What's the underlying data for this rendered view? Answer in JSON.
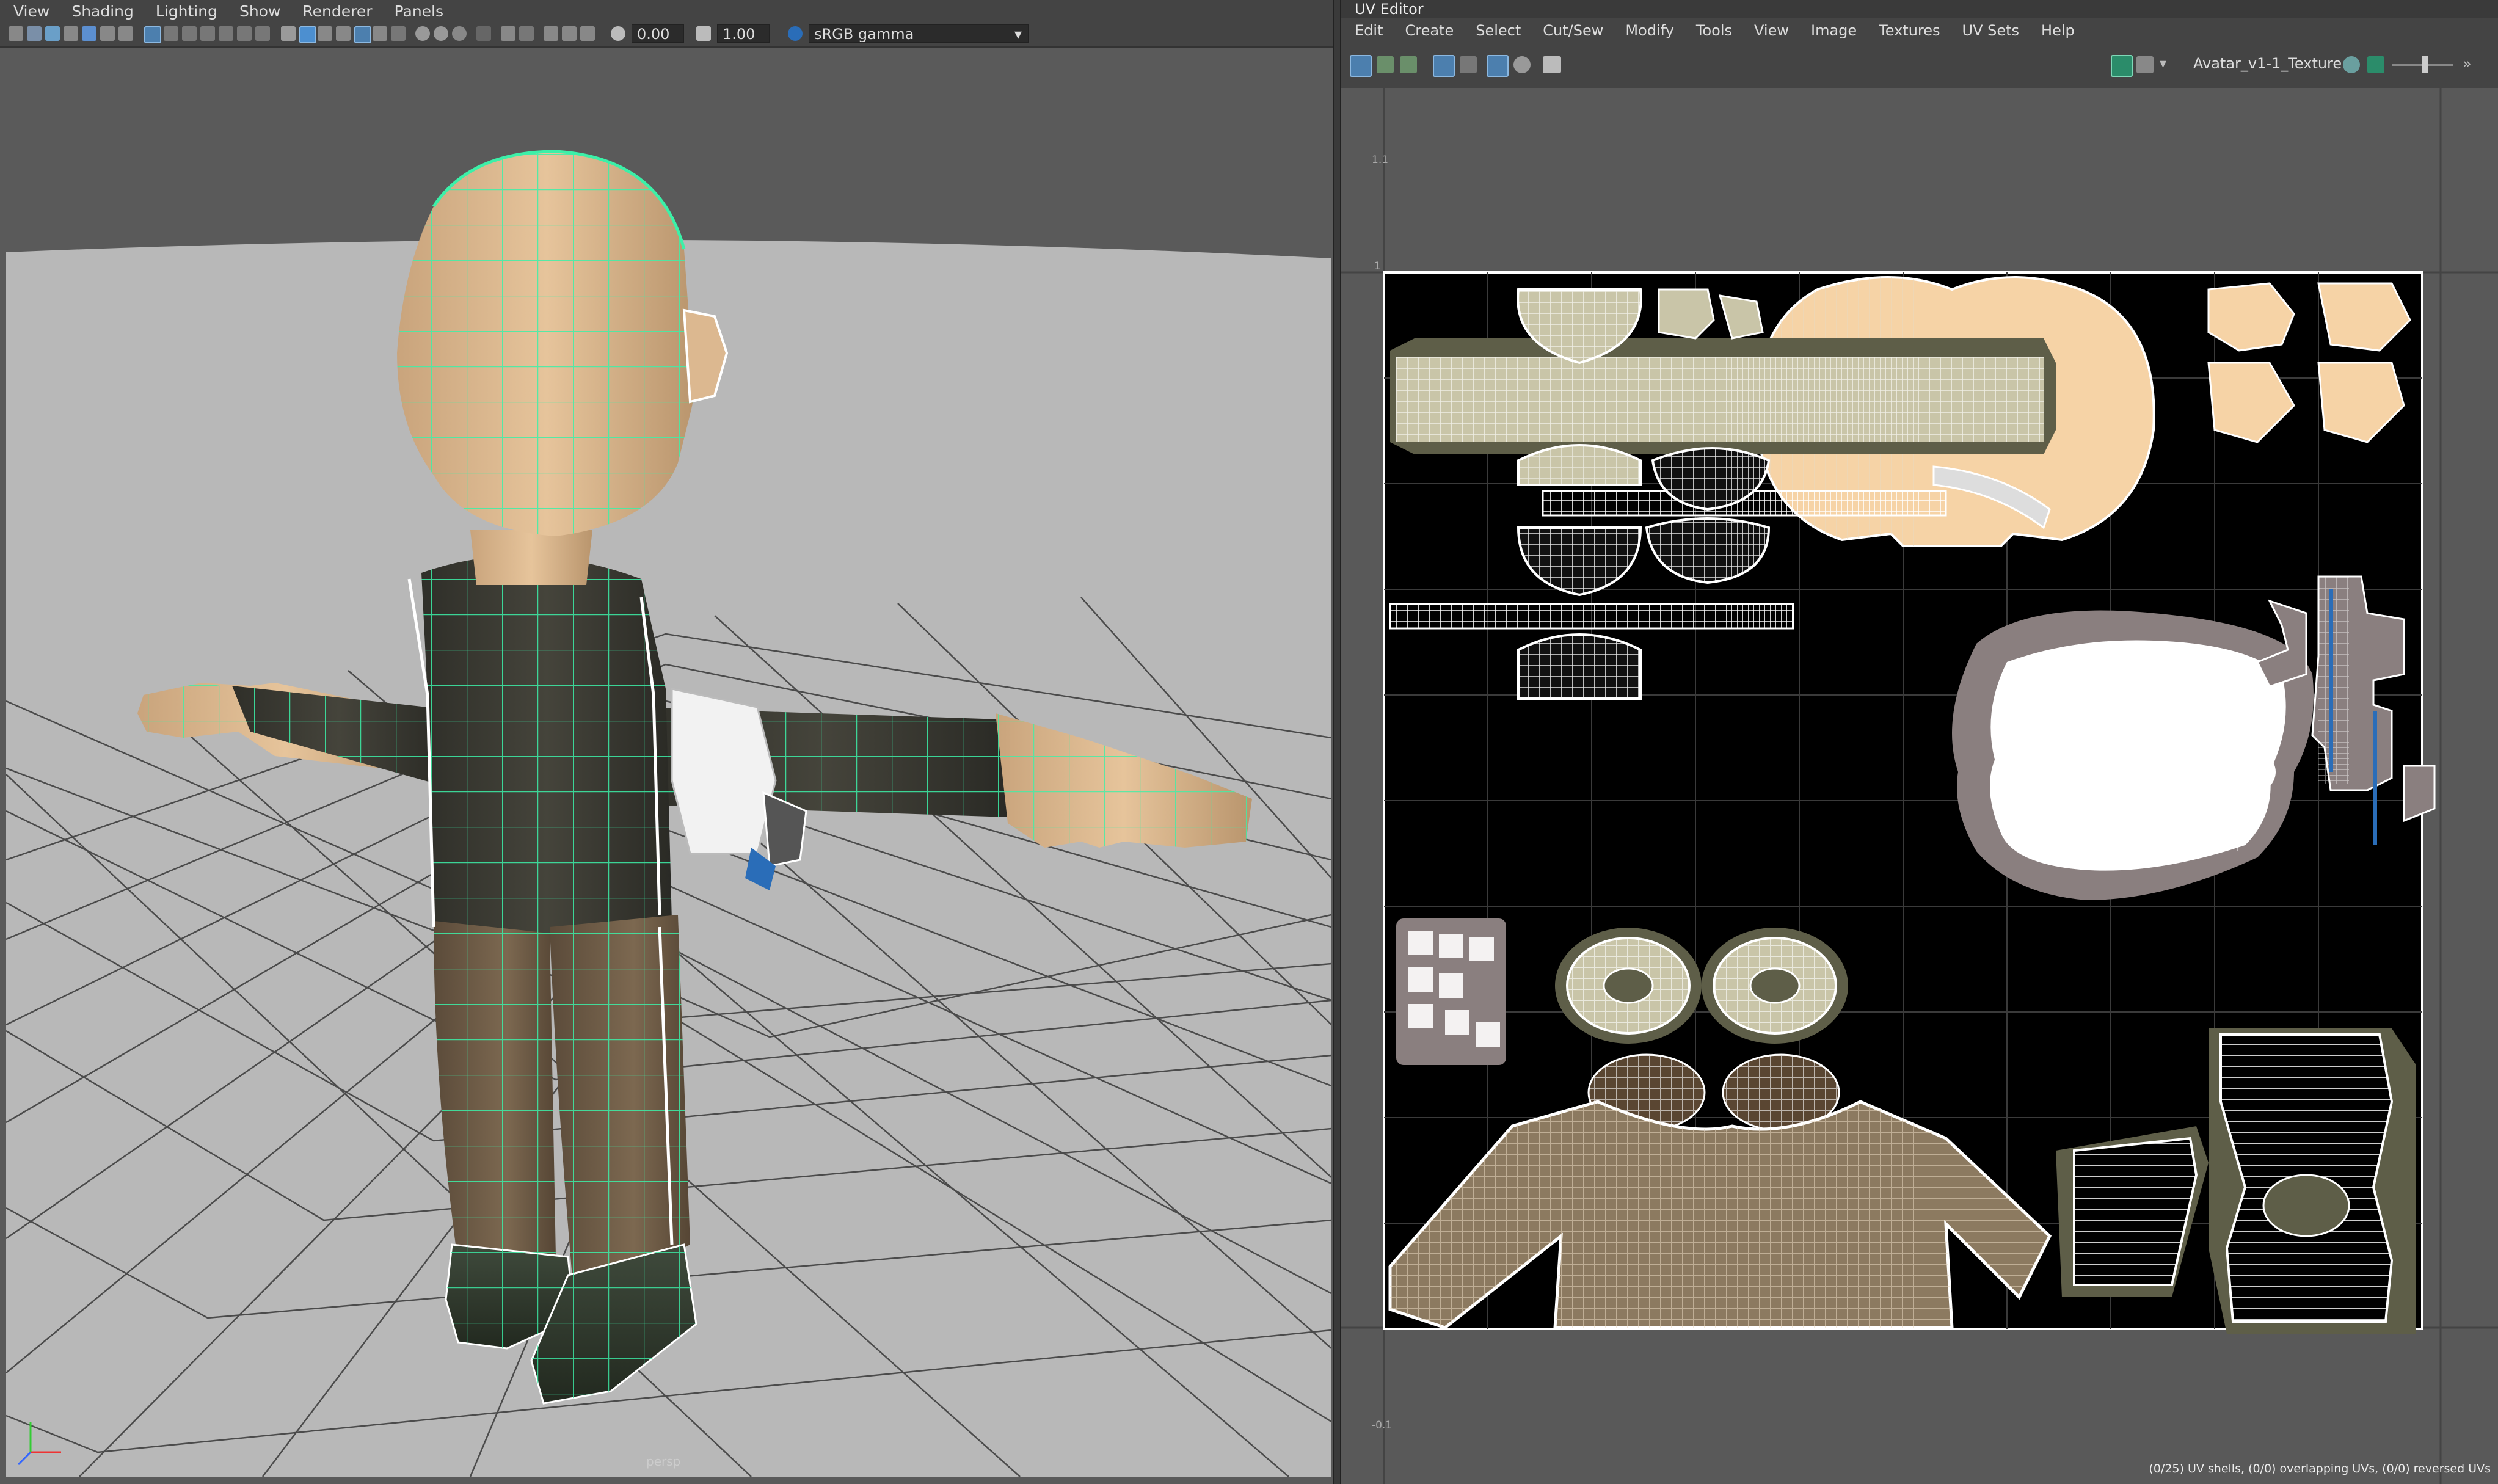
{
  "viewport": {
    "menu": [
      "View",
      "Shading",
      "Lighting",
      "Show",
      "Renderer",
      "Panels"
    ],
    "exposure_value": "0.00",
    "gamma_value": "1.00",
    "color_space": "sRGB gamma",
    "camera_label": "persp"
  },
  "uv_editor": {
    "title": "UV Editor",
    "menu": [
      "Edit",
      "Create",
      "Select",
      "Cut/Sew",
      "Modify",
      "Tools",
      "View",
      "Image",
      "Textures",
      "UV Sets",
      "Help"
    ],
    "texture_name": "Avatar_v1-1_Texture",
    "status": "(0/25) UV shells, (0/0) overlapping UVs, (0/0) reversed UVs",
    "axis_top": "1.1",
    "axis_one": "1",
    "axis_bottom": "-0.1"
  },
  "colors": {
    "viewport_bg": "#5a5a5a",
    "ground": "#b8b8b8",
    "skin": "#e3c097",
    "shirt": "#3b3a33",
    "pants": "#6b5a46",
    "wire": "#3cf0a8",
    "uv_black": "#000000",
    "uv_skin": "#f8d5a8",
    "uv_olive": "#5e5e48",
    "uv_cloth": "#8c7a60",
    "uv_accent": "#2a6db8"
  }
}
